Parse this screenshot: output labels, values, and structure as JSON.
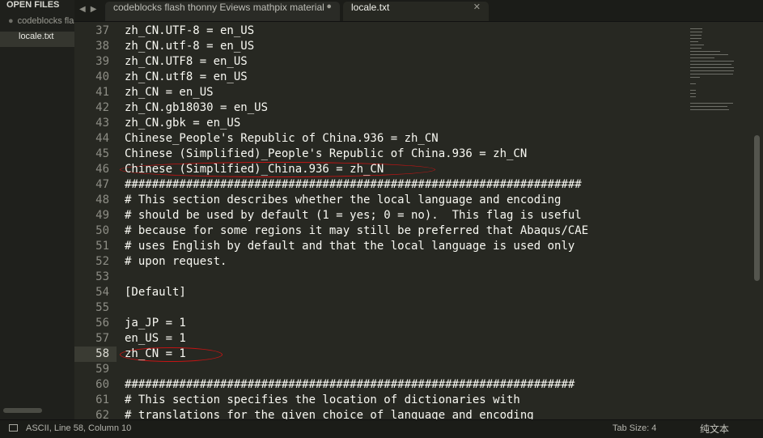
{
  "sidebar": {
    "header": "OPEN FILES",
    "items": [
      {
        "label": "codeblocks  flash thonny  Eviews  mathpix material",
        "modified_marker": "●"
      },
      {
        "label": "locale.txt"
      }
    ]
  },
  "tabs": [
    {
      "label": "codeblocks  flash thonny  Eviews  mathpix material",
      "control": "●"
    },
    {
      "label": "locale.txt",
      "control": "✕"
    }
  ],
  "editor": {
    "current_line": "58",
    "highlight_color": "#c21414",
    "lines": [
      {
        "n": "37",
        "text": "zh_CN.UTF-8 = en_US"
      },
      {
        "n": "38",
        "text": "zh_CN.utf-8 = en_US"
      },
      {
        "n": "39",
        "text": "zh_CN.UTF8 = en_US"
      },
      {
        "n": "40",
        "text": "zh_CN.utf8 = en_US"
      },
      {
        "n": "41",
        "text": "zh_CN = en_US"
      },
      {
        "n": "42",
        "text": "zh_CN.gb18030 = en_US"
      },
      {
        "n": "43",
        "text": "zh_CN.gbk = en_US"
      },
      {
        "n": "44",
        "text": "Chinese_People's Republic of China.936 = zh_CN"
      },
      {
        "n": "45",
        "text": "Chinese (Simplified)_People's Republic of China.936 = zh_CN"
      },
      {
        "n": "46",
        "text": "Chinese (Simplified)_China.936 = zh_CN"
      },
      {
        "n": "47",
        "text": "###################################################################"
      },
      {
        "n": "48",
        "text": "# This section describes whether the local language and encoding"
      },
      {
        "n": "49",
        "text": "# should be used by default (1 = yes; 0 = no).  This flag is useful"
      },
      {
        "n": "50",
        "text": "# because for some regions it may still be preferred that Abaqus/CAE"
      },
      {
        "n": "51",
        "text": "# uses English by default and that the local language is used only"
      },
      {
        "n": "52",
        "text": "# upon request."
      },
      {
        "n": "53",
        "text": ""
      },
      {
        "n": "54",
        "text": "[Default]"
      },
      {
        "n": "55",
        "text": ""
      },
      {
        "n": "56",
        "text": "ja_JP = 1"
      },
      {
        "n": "57",
        "text": "en_US = 1"
      },
      {
        "n": "58",
        "text": "zh_CN = 1"
      },
      {
        "n": "59",
        "text": ""
      },
      {
        "n": "60",
        "text": "##################################################################"
      },
      {
        "n": "61",
        "text": "# This section specifies the location of dictionaries with"
      },
      {
        "n": "62",
        "text": "# translations for the given choice of language and encoding"
      }
    ]
  },
  "status": {
    "text": "ASCII, Line 58, Column 10",
    "tab_size": "Tab Size: 4",
    "syntax": "纯文本"
  },
  "icons": {
    "nav_back": "caret-left-icon",
    "nav_forward": "caret-right-icon",
    "status_panel": "panel-toggle-icon"
  }
}
